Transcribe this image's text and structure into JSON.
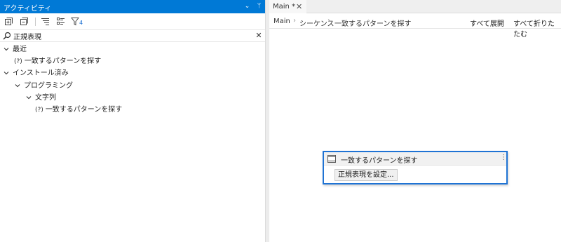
{
  "activities_panel": {
    "title": "アクティビティ",
    "menu_glyph": "⌄",
    "pin_glyph": "ᛘ",
    "filter_count": "4",
    "search": {
      "value": "正規表現",
      "clear_glyph": "✕"
    },
    "tree": [
      {
        "label": "最近",
        "level": 0,
        "type": "group",
        "expanded": true
      },
      {
        "label": "一致するパターンを探す",
        "level": 1,
        "type": "activity",
        "icon": "(?)"
      },
      {
        "label": "インストール済み",
        "level": 0,
        "type": "group",
        "expanded": true
      },
      {
        "label": "プログラミング",
        "level": 1,
        "type": "group",
        "expanded": true
      },
      {
        "label": "文字列",
        "level": 2,
        "type": "group",
        "expanded": true
      },
      {
        "label": "一致するパターンを探す",
        "level": 3,
        "type": "activity",
        "icon": "(?)"
      }
    ]
  },
  "designer": {
    "tab": {
      "label": "Main *",
      "close_glyph": "✕"
    },
    "breadcrumb": [
      "Main",
      "シーケンス",
      "一致するパターンを探す"
    ],
    "breadcrumb_sep": "›",
    "expand_all": "すべて展開",
    "collapse_all": "すべて折りたたむ",
    "activity_card": {
      "title": "一致するパターンを探す",
      "menu_glyph": "⋮",
      "button_label": "正規表現を設定..."
    }
  },
  "colors": {
    "titlebar": "#0079d6",
    "selection_border": "#1f73d4"
  }
}
